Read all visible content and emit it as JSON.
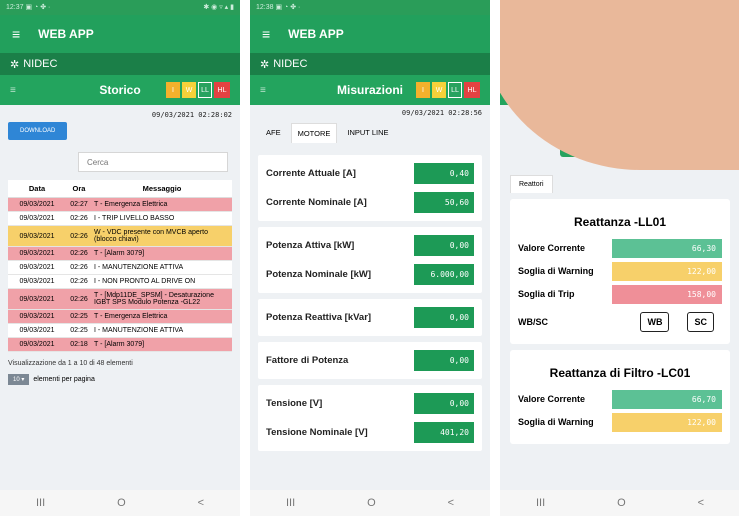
{
  "status_left_1": "12:37 ▣ ◔ ✤ ·",
  "status_right_1": "✱ ◉ ▿ ▴ ▮",
  "status_left_2": "12:38 ▣ ◔ ✤ ·",
  "app_title": "WEB APP",
  "brand": "NIDEC",
  "badges": {
    "i": "I",
    "w": "W",
    "ll": "LL",
    "hl": "HL"
  },
  "screen1": {
    "title": "Storico",
    "timestamp": "09/03/2021 02:28:02",
    "download_label": "DOWNLOAD",
    "search_placeholder": "Cerca",
    "columns": [
      "Data",
      "Ora",
      "Messaggio"
    ],
    "rows": [
      {
        "date": "09/03/2021",
        "time": "02:27",
        "msg": "T - Emergenza Elettrica",
        "color": "red"
      },
      {
        "date": "09/03/2021",
        "time": "02:26",
        "msg": "I - TRIP LIVELLO BASSO",
        "color": "wht"
      },
      {
        "date": "09/03/2021",
        "time": "02:26",
        "msg": "W - VDC presente con MVCB aperto (blocco chiavi)",
        "color": "yel"
      },
      {
        "date": "09/03/2021",
        "time": "02:26",
        "msg": "T - [Alarm 3079]",
        "color": "red"
      },
      {
        "date": "09/03/2021",
        "time": "02:26",
        "msg": "I - MANUTENZIONE ATTIVA",
        "color": "wht"
      },
      {
        "date": "09/03/2021",
        "time": "02:26",
        "msg": "I - NON PRONTO AL DRIVE ON",
        "color": "wht"
      },
      {
        "date": "09/03/2021",
        "time": "02:26",
        "msg": "T - [Mdp11DE_SPSM] - Desaturazione IGBT SPS Modulo Potenza -GL22",
        "color": "red"
      },
      {
        "date": "09/03/2021",
        "time": "02:25",
        "msg": "T - Emergenza Elettrica",
        "color": "red"
      },
      {
        "date": "09/03/2021",
        "time": "02:25",
        "msg": "I - MANUTENZIONE ATTIVA",
        "color": "wht"
      },
      {
        "date": "09/03/2021",
        "time": "02:18",
        "msg": "T - [Alarm 3079]",
        "color": "red"
      }
    ],
    "info": "Visualizzazione da 1 a 10 di 48 elementi",
    "perpage_value": "10 ▾",
    "perpage_label": "elementi per pagina"
  },
  "screen2": {
    "title": "Misurazioni",
    "timestamp": "09/03/2021 02:28:56",
    "tabs": [
      "AFE",
      "MOTORE",
      "INPUT LINE"
    ],
    "cards": [
      [
        {
          "label": "Corrente Attuale [A]",
          "value": "0,40"
        },
        {
          "label": "Corrente Nominale [A]",
          "value": "50,60"
        }
      ],
      [
        {
          "label": "Potenza Attiva [kW]",
          "value": "0,00"
        },
        {
          "label": "Potenza Nominale [kW]",
          "value": "6.000,00"
        }
      ],
      [
        {
          "label": "Potenza Reattiva [kVar]",
          "value": "0,00"
        }
      ],
      [
        {
          "label": "Fattore di Potenza",
          "value": "0,00"
        }
      ],
      [
        {
          "label": "Tensione [V]",
          "value": "0,00"
        },
        {
          "label": "Tensione Nominale [V]",
          "value": "401,20"
        }
      ]
    ]
  },
  "screen3": {
    "btn_f": "°F",
    "tab": "Reattori",
    "card1": {
      "title": "Reattanza -LL01",
      "rows": [
        {
          "label": "Valore Corrente",
          "value": "66,30"
        },
        {
          "label": "Soglia di Warning",
          "value": "122,00"
        },
        {
          "label": "Soglia di Trip",
          "value": "158,00"
        }
      ],
      "wb_label": "WB/SC",
      "wb": "WB",
      "sc": "SC"
    },
    "card2": {
      "title": "Reattanza di Filtro -LC01",
      "rows": [
        {
          "label": "Valore Corrente",
          "value": "66,70"
        },
        {
          "label": "Soglia di Warning",
          "value": "122,00"
        }
      ]
    }
  },
  "nav": {
    "recent": "III",
    "home": "O",
    "back": "<"
  }
}
